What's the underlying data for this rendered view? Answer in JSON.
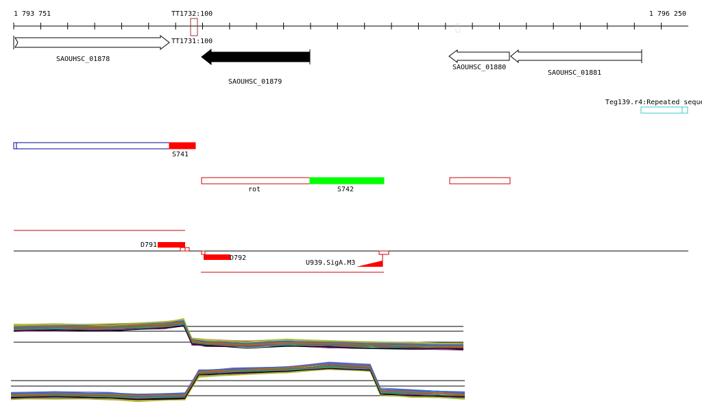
{
  "ruler": {
    "start_label": "1 793 751",
    "end_label": "1 796 250"
  },
  "terminators": {
    "tt1732": "TT1732:100",
    "tt1731": "TT1731:100"
  },
  "genes": {
    "g1878": "SAOUHSC_01878",
    "g1879": "SAOUHSC_01879",
    "g1880": "SAOUHSC_01880",
    "g1881": "SAOUHSC_01881"
  },
  "repeat": {
    "label": "Teg139.r4:Repeated seque"
  },
  "segments": {
    "s741": "S741",
    "rot": "rot",
    "s742": "S742"
  },
  "features": {
    "d791": "D791",
    "d792": "D792",
    "u939": "U939.SigA.M3"
  },
  "colors": {
    "red": "#ff0000",
    "darkred": "#cc0000",
    "green": "#00ff00",
    "blue": "#000099",
    "cyan": "#33cccc"
  }
}
